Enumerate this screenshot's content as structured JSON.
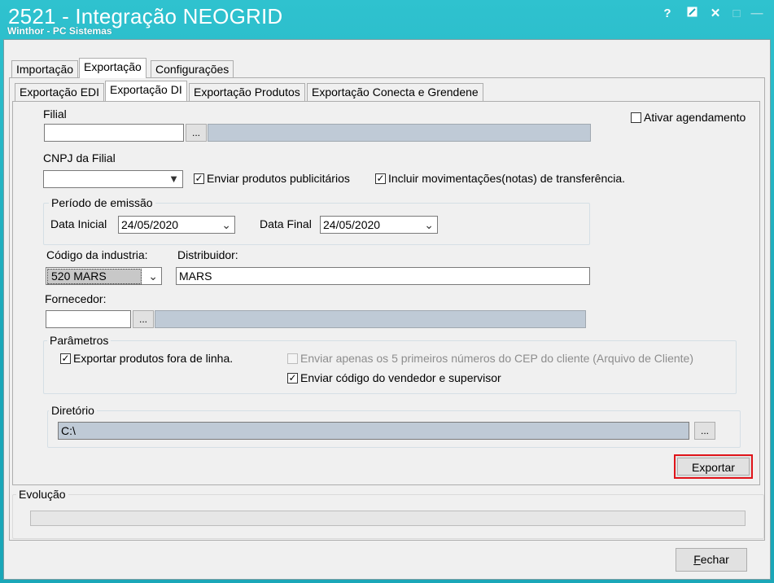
{
  "window": {
    "title": "2521 - Integração NEOGRID",
    "subtitle": "Winthor - PC Sistemas",
    "controls": {
      "help": "?",
      "edit": "✎",
      "close": "✕",
      "maximize": "□",
      "minimize": "—"
    }
  },
  "main_tabs": [
    "Importação",
    "Exportação",
    "Configurações"
  ],
  "sub_tabs": [
    "Exportação EDI",
    "Exportação DI",
    "Exportação Produtos",
    "Exportação Conecta e Grendene"
  ],
  "form": {
    "filial_label": "Filial",
    "filial_value": "",
    "filial_dots": "...",
    "ativar_agendamento": {
      "label": "Ativar agendamento",
      "checked": false
    },
    "cnpj_label": "CNPJ da Filial",
    "cnpj_value": "",
    "enviar_publicitarios": {
      "label": "Enviar produtos publicitários",
      "checked": true
    },
    "incluir_transferencia": {
      "label": "Incluir movimentações(notas) de transferência.",
      "checked": true
    },
    "periodo": {
      "title": "Período de emissão",
      "data_inicial_label": "Data Inicial",
      "data_inicial_value": "24/05/2020",
      "data_final_label": "Data Final",
      "data_final_value": "24/05/2020"
    },
    "codigo_industria_label": "Código da industria:",
    "codigo_industria_value": "520 MARS",
    "distribuidor_label": "Distribuidor:",
    "distribuidor_value": "MARS",
    "fornecedor_label": "Fornecedor:",
    "fornecedor_value": "",
    "fornecedor_dots": "...",
    "parametros": {
      "title": "Parâmetros",
      "fora_de_linha": {
        "label": "Exportar produtos fora de linha.",
        "checked": true
      },
      "cep_cliente": {
        "label": "Enviar apenas os 5 primeiros números do CEP do cliente (Arquivo de Cliente)",
        "checked": false,
        "disabled": true
      },
      "vendedor_supervisor": {
        "label": "Enviar código do vendedor e supervisor",
        "checked": true
      }
    },
    "diretorio": {
      "title": "Diretório",
      "value": "C:\\",
      "dots": "..."
    },
    "exportar_label": "Exportar"
  },
  "evolucao": {
    "title": "Evolução",
    "progress": 0
  },
  "fechar_label": "Fechar",
  "colors": {
    "titlebar": "#1aa7b8",
    "highlight_border": "#e0141a",
    "gray_field": "#bfcad6"
  }
}
